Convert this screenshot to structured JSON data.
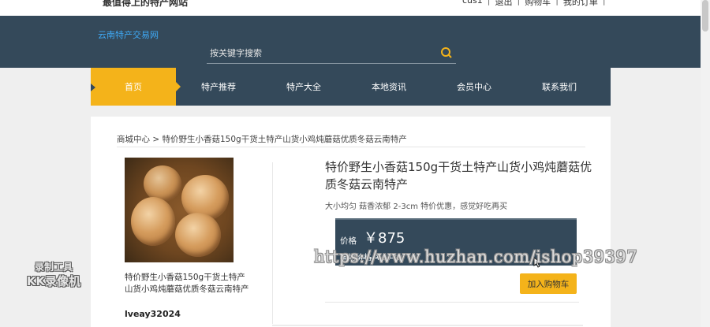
{
  "topbar": {
    "slogan": "最值得上的特产网站",
    "links": [
      "cus1",
      "退出",
      "购物车",
      "我的订单"
    ],
    "separator": "|"
  },
  "header": {
    "logo": "云南特产交易网",
    "search_placeholder": "按关键字搜索",
    "search_icon": "search-icon"
  },
  "nav": {
    "items": [
      {
        "label": "首页",
        "active": true
      },
      {
        "label": "特产推荐"
      },
      {
        "label": "特产大全"
      },
      {
        "label": "本地资讯"
      },
      {
        "label": "会员中心"
      },
      {
        "label": "联系我们"
      }
    ]
  },
  "breadcrumb": {
    "home": "商城中心",
    "sep": ">",
    "current": "特价野生小香菇150g干货土特产山货小鸡炖蘑菇优质冬菇云南特产"
  },
  "product": {
    "thumb_title": "特价野生小香菇150g干货土特产山货小鸡炖蘑菇优质冬菇云南特产",
    "seller": "lveay32024",
    "title": "特价野生小香菇150g干货土特产山货小鸡炖蘑菇优质冬菇云南特产",
    "description": "大小均匀 菇香浓郁 2-3cm 特价优惠，感觉好吃再买",
    "price_label": "价格",
    "price": "￥875",
    "market_price": "市场价格:￥8779",
    "cart_button": "加入购物车"
  },
  "watermarks": {
    "url": "https://www.huzhan.com/ishop39397",
    "badge_line1": "录制工具",
    "badge_line2": "KK录像机"
  },
  "colors": {
    "header_bg": "#34495a",
    "accent": "#f4b31a",
    "logo": "#3fa9f5"
  }
}
